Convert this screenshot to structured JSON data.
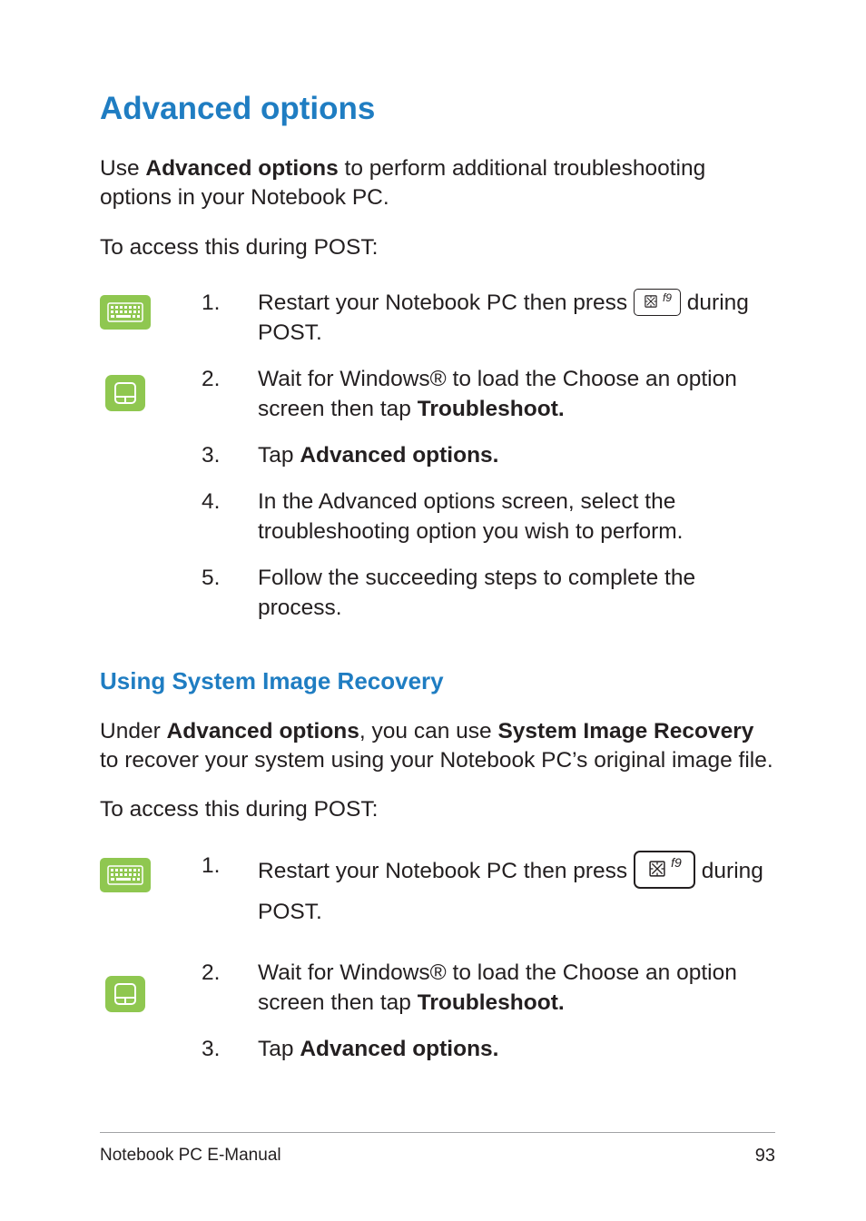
{
  "heading1": "Advanced options",
  "intro_pre": "Use ",
  "intro_bold": "Advanced options",
  "intro_post": " to perform additional troubleshooting options in your Notebook PC.",
  "access_line": "To access this during POST:",
  "steps_a": {
    "n1": "1.",
    "t1a": "Restart your Notebook PC then press ",
    "t1b": " during POST.",
    "n2": "2.",
    "t2a": "Wait for Windows® to load the Choose an option screen then tap ",
    "t2b": "Troubleshoot.",
    "n3": "3.",
    "t3a": "Tap ",
    "t3b": "Advanced options.",
    "n4": "4.",
    "t4": "In the Advanced options screen, select the troubleshooting option you wish to perform.",
    "n5": "5.",
    "t5": "Follow the succeeding steps to complete the process."
  },
  "heading2": "Using System Image Recovery",
  "sir_pre": "Under ",
  "sir_b1": "Advanced options",
  "sir_mid": ", you can use ",
  "sir_b2": "System Image Recovery",
  "sir_post": " to recover your system using your Notebook PC’s original image file.",
  "steps_b": {
    "n1": "1.",
    "t1a": "Restart your Notebook PC then press ",
    "t1b": " during POST.",
    "n2": "2.",
    "t2a": "Wait for Windows® to load the Choose an option screen then tap ",
    "t2b": "Troubleshoot.",
    "n3": "3.",
    "t3a": "Tap ",
    "t3b": "Advanced options."
  },
  "key_label": "f9",
  "footer_left": "Notebook PC E-Manual",
  "footer_right": "93"
}
